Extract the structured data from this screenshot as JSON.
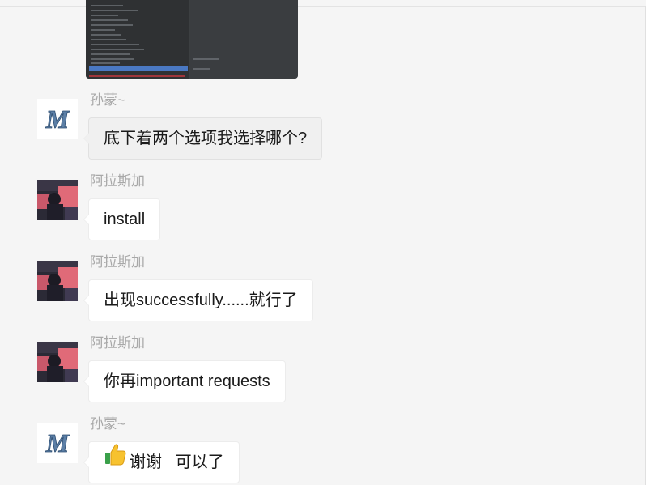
{
  "messages": [
    {
      "sender": "孙蒙~",
      "text": "底下着两个选项我选择哪个?",
      "avatar": "m-logo-avatar"
    },
    {
      "sender": "阿拉斯加",
      "text": "install",
      "avatar": "photo-avatar"
    },
    {
      "sender": "阿拉斯加",
      "text": "出现successfully......就行了",
      "avatar": "photo-avatar"
    },
    {
      "sender": "阿拉斯加",
      "text": "你再important requests",
      "avatar": "photo-avatar"
    },
    {
      "sender": "孙蒙~",
      "text": "谢谢   可以了",
      "emoji": "thumbs-up-icon",
      "avatar": "m-logo-avatar"
    }
  ],
  "colors": {
    "background": "#f5f5f5",
    "bubble": "#ffffff",
    "bubble_self": "#f0f0f0",
    "sender_name": "#a8a8a8",
    "text": "#1a1a1a"
  }
}
